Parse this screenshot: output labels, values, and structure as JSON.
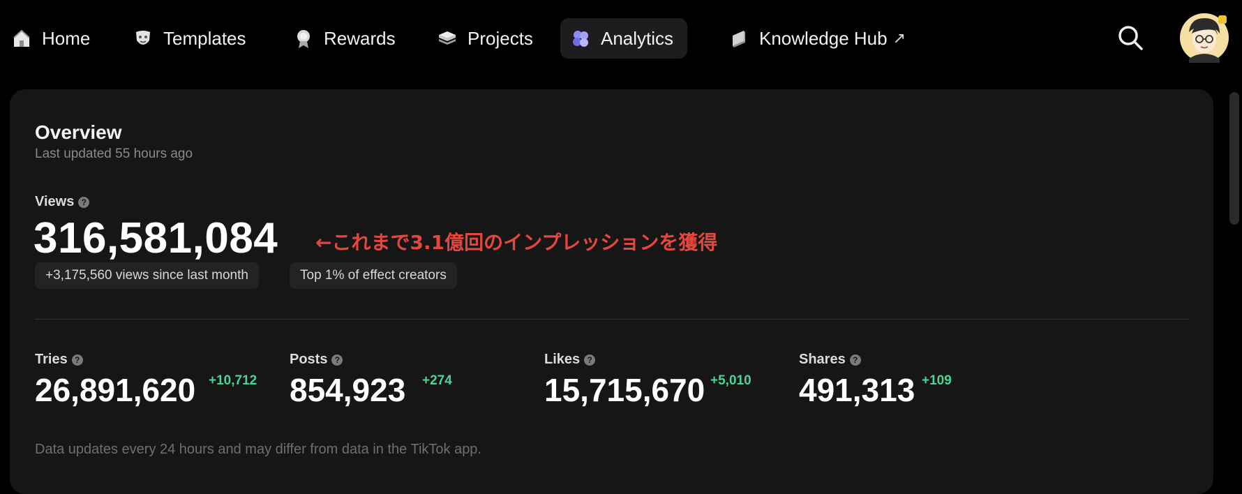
{
  "nav": {
    "items": [
      {
        "label": "Home"
      },
      {
        "label": "Templates"
      },
      {
        "label": "Rewards"
      },
      {
        "label": "Projects"
      },
      {
        "label": "Analytics"
      },
      {
        "label": "Knowledge Hub",
        "external_marker": "↗"
      }
    ],
    "active": "Analytics"
  },
  "overview": {
    "title": "Overview",
    "last_updated": "Last updated 55 hours ago",
    "views": {
      "label": "Views",
      "value": "316,581,084",
      "annotation": "←これまで3.1億回のインプレッションを獲得",
      "chips": [
        "+3,175,560 views since last month",
        "Top 1% of effect creators"
      ]
    },
    "stats": [
      {
        "label": "Tries",
        "value": "26,891,620",
        "delta": "+10,712"
      },
      {
        "label": "Posts",
        "value": "854,923",
        "delta": "+274"
      },
      {
        "label": "Likes",
        "value": "15,715,670",
        "delta": "+5,010"
      },
      {
        "label": "Shares",
        "value": "491,313",
        "delta": "+109"
      }
    ],
    "help_glyph": "?",
    "footnote": "Data updates every 24 hours and may differ from data in the TikTok app."
  },
  "colors": {
    "background": "#000000",
    "card": "#161616",
    "active_tab": "#1d1d1f",
    "delta_positive": "#48d597",
    "annotation": "#e5473c"
  },
  "icons": [
    "home-icon",
    "templates-icon",
    "rewards-icon",
    "projects-icon",
    "analytics-icon",
    "knowledge-hub-icon",
    "search-icon",
    "avatar"
  ]
}
